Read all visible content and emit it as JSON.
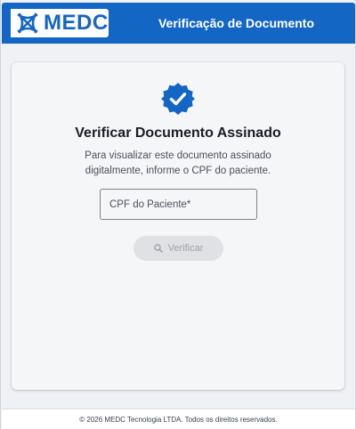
{
  "header": {
    "logo_text": "MEDC",
    "title": "Verificação de Documento"
  },
  "card": {
    "icon": "verified-badge-icon",
    "title": "Verificar Documento Assinado",
    "description": "Para visualizar este documento assinado digitalmente, informe o CPF do paciente."
  },
  "form": {
    "cpf_placeholder": "CPF do Paciente*",
    "cpf_value": "",
    "verify_button_label": "Verificar",
    "verify_button_icon": "search-icon",
    "verify_button_enabled": false
  },
  "footer": {
    "text": "© 2026 MEDC Tecnologia LTDA. Todos os direitos reservados."
  },
  "colors": {
    "brand": "#1466c4",
    "button_disabled_bg": "#dfe1e5",
    "button_disabled_text": "#9ea2a9"
  }
}
